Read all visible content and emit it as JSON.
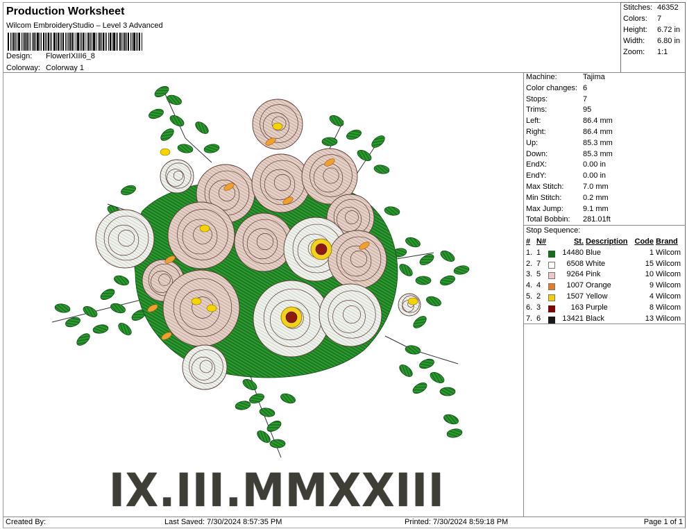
{
  "header": {
    "title": "Production Worksheet",
    "subtitle": "Wilcom EmbroideryStudio – Level 3 Advanced",
    "design_label": "Design:",
    "design_value": "FlowerIXIII6_8",
    "colorway_label": "Colorway:",
    "colorway_value": "Colorway 1"
  },
  "summary": {
    "stitches_label": "Stitches:",
    "stitches": "46352",
    "colors_label": "Colors:",
    "colors": "7",
    "height_label": "Height:",
    "height": "6.72 in",
    "width_label": "Width:",
    "width": "6.80 in",
    "zoom_label": "Zoom:",
    "zoom": "1:1"
  },
  "machine_info": [
    {
      "label": "Machine:",
      "value": "Tajima"
    },
    {
      "label": "Color changes:",
      "value": "6"
    },
    {
      "label": "Stops:",
      "value": "7"
    },
    {
      "label": "Trims:",
      "value": "95"
    },
    {
      "label": "Left:",
      "value": "86.4 mm"
    },
    {
      "label": "Right:",
      "value": "86.4 mm"
    },
    {
      "label": "Up:",
      "value": "85.3 mm"
    },
    {
      "label": "Down:",
      "value": "85.3 mm"
    },
    {
      "label": "EndX:",
      "value": "0.00 in"
    },
    {
      "label": "EndY:",
      "value": "0.00 in"
    },
    {
      "label": "Max Stitch:",
      "value": "7.0 mm"
    },
    {
      "label": "Min Stitch:",
      "value": "0.2 mm"
    },
    {
      "label": "Max Jump:",
      "value": "9.1 mm"
    },
    {
      "label": "Total Bobbin:",
      "value": "281.01ft"
    }
  ],
  "stop_sequence": {
    "label": "Stop Sequence:",
    "headers": {
      "num": "#",
      "n": "N#",
      "st": "St.",
      "desc": "Description",
      "code": "Code",
      "brand": "Brand"
    },
    "rows": [
      {
        "num": "1.",
        "n": "1",
        "color": "#1a6b1e",
        "st": "14480",
        "desc": "Blue",
        "code": "1",
        "brand": "Wilcom"
      },
      {
        "num": "2.",
        "n": "7",
        "color": "#ffffff",
        "st": "6508",
        "desc": "White",
        "code": "15",
        "brand": "Wilcom"
      },
      {
        "num": "3.",
        "n": "5",
        "color": "#f2c4cc",
        "st": "9264",
        "desc": "Pink",
        "code": "10",
        "brand": "Wilcom"
      },
      {
        "num": "4.",
        "n": "4",
        "color": "#e87a22",
        "st": "1007",
        "desc": "Orange",
        "code": "9",
        "brand": "Wilcom"
      },
      {
        "num": "5.",
        "n": "2",
        "color": "#f5cf00",
        "st": "1507",
        "desc": "Yellow",
        "code": "4",
        "brand": "Wilcom"
      },
      {
        "num": "6.",
        "n": "3",
        "color": "#7a0a0a",
        "st": "163",
        "desc": "Purple",
        "code": "8",
        "brand": "Wilcom"
      },
      {
        "num": "7.",
        "n": "6",
        "color": "#1a1a1a",
        "st": "13421",
        "desc": "Black",
        "code": "13",
        "brand": "Wilcom"
      }
    ]
  },
  "design": {
    "lettering": "IX.III.MMXXIII",
    "description": "Embroidered flower bouquet with green leaves, pink and white peonies, yellow and orange accents"
  },
  "footer": {
    "created_by": "Created By:",
    "last_saved": "Last Saved: 7/30/2024 8:57:35 PM",
    "printed": "Printed: 7/30/2024 8:59:18 PM",
    "page": "Page 1 of 1"
  }
}
